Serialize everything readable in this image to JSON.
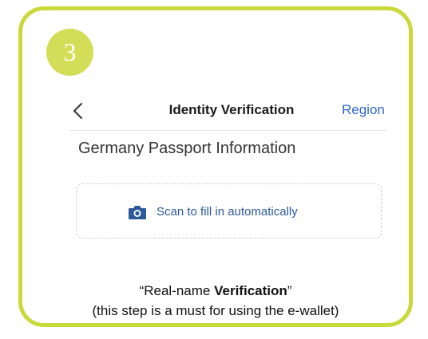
{
  "step_badge": {
    "number": "3"
  },
  "nav": {
    "back_icon": "chevron-left-icon",
    "title": "Identity Verification",
    "region_label": "Region"
  },
  "section": {
    "title": "Germany Passport Information"
  },
  "scan": {
    "icon": "camera-icon",
    "label": "Scan to fill in automatically"
  },
  "caption": {
    "prefix": "“Real-name ",
    "bold_text": "Verification",
    "suffix": "”",
    "note": "(this step is a must for using the e-wallet)"
  },
  "colors": {
    "frame_border": "#c9d93a",
    "badge_fill": "#d4dd58",
    "region_link": "#2f67c9",
    "scan_label": "#2d5a9b"
  }
}
